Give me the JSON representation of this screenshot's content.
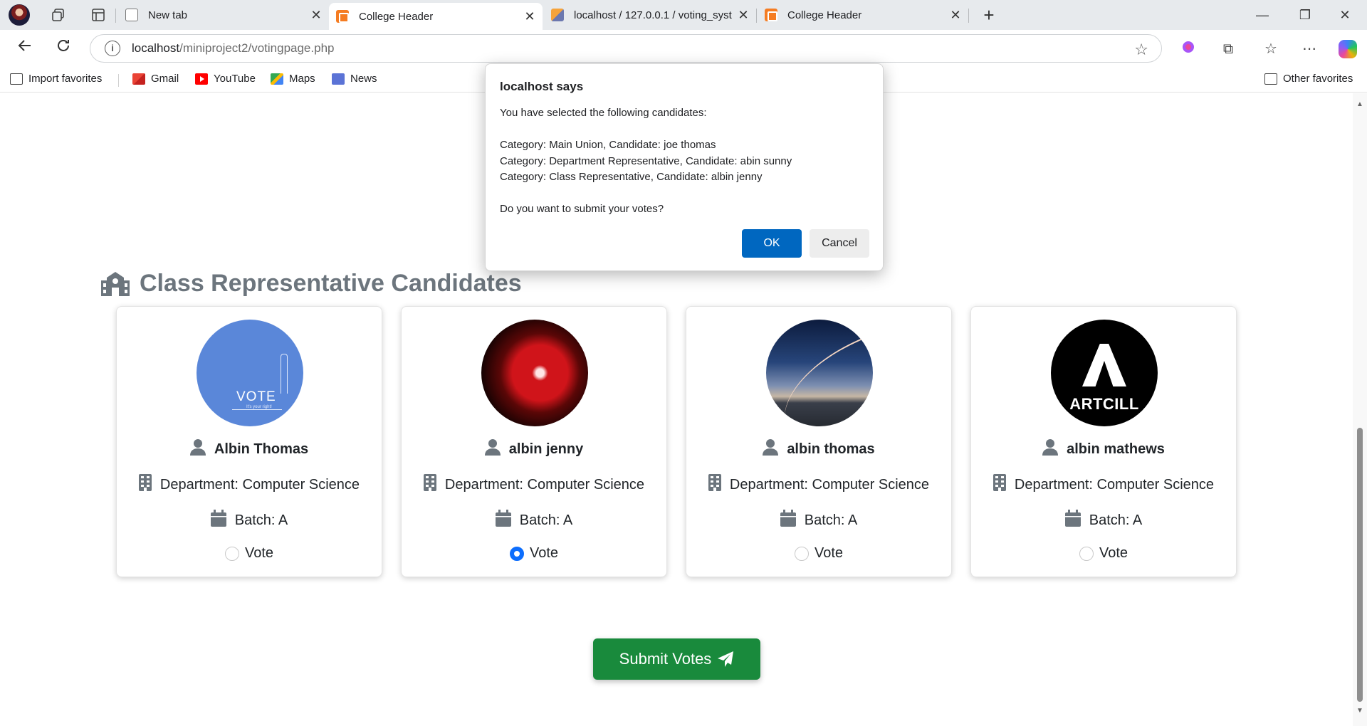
{
  "browser": {
    "tabs": [
      {
        "title": "New tab",
        "icon": "new-tab-icon",
        "active": false
      },
      {
        "title": "College Header",
        "icon": "xampp-icon",
        "active": true
      },
      {
        "title": "localhost / 127.0.0.1 / voting_syst",
        "icon": "phpmyadmin-icon",
        "active": false
      },
      {
        "title": "College Header",
        "icon": "xampp-icon",
        "active": false
      }
    ],
    "url_host": "localhost",
    "url_path": "/miniproject2/votingpage.php",
    "bookmarks": [
      {
        "label": "Import favorites",
        "icon": "import-icon"
      },
      {
        "label": "Gmail",
        "icon": "gmail-icon"
      },
      {
        "label": "YouTube",
        "icon": "youtube-icon"
      },
      {
        "label": "Maps",
        "icon": "maps-icon"
      },
      {
        "label": "News",
        "icon": "news-icon"
      }
    ],
    "other_favorites": "Other favorites"
  },
  "page": {
    "section_title": "Class Representative Candidates",
    "candidates": [
      {
        "name": "Albin Thomas",
        "department": "Department: Computer Science",
        "batch": "Batch: A",
        "vote_label": "Vote",
        "selected": false,
        "photo": "vote-illustration"
      },
      {
        "name": "albin jenny",
        "department": "Department: Computer Science",
        "batch": "Batch: A",
        "vote_label": "Vote",
        "selected": true,
        "photo": "red-figure"
      },
      {
        "name": "albin thomas",
        "department": "Department: Computer Science",
        "batch": "Batch: A",
        "vote_label": "Vote",
        "selected": false,
        "photo": "night-sky"
      },
      {
        "name": "albin mathews",
        "department": "Department: Computer Science",
        "batch": "Batch: A",
        "vote_label": "Vote",
        "selected": false,
        "photo": "artcill-logo"
      }
    ],
    "photo_texts": {
      "vote": "VOTE",
      "vote_sub": "It's your right!",
      "artcill": "ARTCILL"
    },
    "submit_label": "Submit Votes"
  },
  "dialog": {
    "title": "localhost says",
    "lines": [
      "You have selected the following candidates:",
      "",
      "Category: Main Union, Candidate: joe thomas",
      "Category: Department Representative, Candidate: abin sunny",
      "Category: Class Representative, Candidate: albin jenny",
      "",
      "Do you want to submit your votes?"
    ],
    "ok_label": "OK",
    "cancel_label": "Cancel"
  },
  "colors": {
    "primary": "#0d6efd",
    "submit_green": "#198a3c",
    "dialog_ok": "#0067c0",
    "heading_gray": "#6c757d"
  }
}
